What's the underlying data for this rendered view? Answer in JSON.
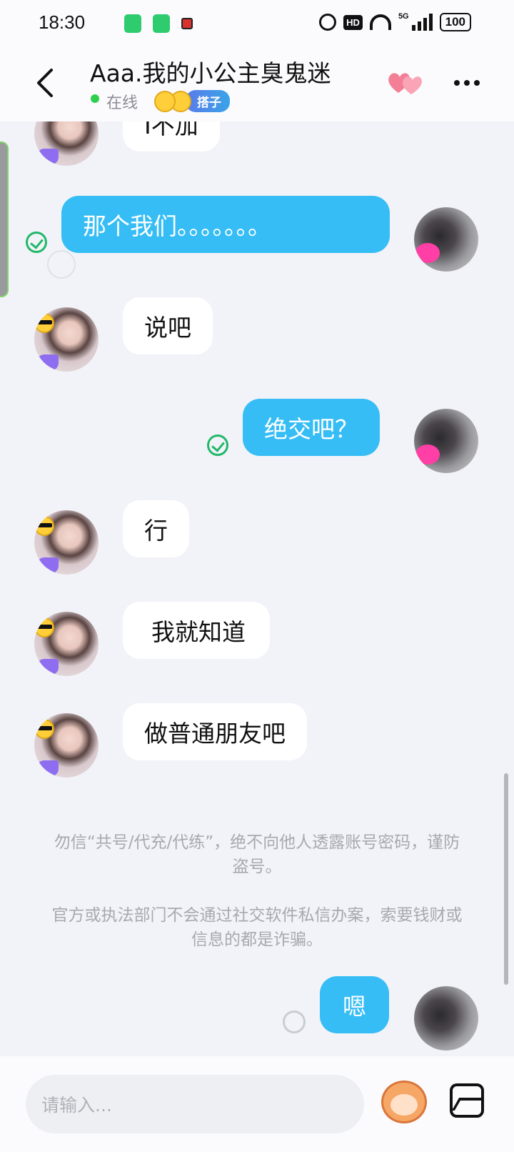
{
  "status_bar": {
    "time": "18:30",
    "network": "5G",
    "hd": "HD",
    "battery": "100"
  },
  "header": {
    "title": "Aaa.我的小公主臭鬼迷",
    "status": "在线",
    "tag": "搭子",
    "back_icon": "back-arrow-icon",
    "heart_icon": "hearts-icon",
    "more_icon": "more-dots-icon"
  },
  "messages": [
    {
      "side": "in",
      "text": "I不加"
    },
    {
      "side": "out",
      "text": "那个我们。。。。。。。"
    },
    {
      "side": "in",
      "text": "说吧"
    },
    {
      "side": "out",
      "text": "绝交吧？"
    },
    {
      "side": "in",
      "text": "行"
    },
    {
      "side": "in",
      "text": "我就知道"
    },
    {
      "side": "in",
      "text": "做普通朋友吧"
    }
  ],
  "notices": [
    "勿信“共号/代充/代练”，绝不向他人透露账号密码，谨防盗号。",
    "官方或执法部门不会通过社交软件私信办案，索要钱财或信息的都是诈骗。"
  ],
  "last_message": {
    "side": "out",
    "text": "嗯"
  },
  "input": {
    "placeholder": "请输入..."
  },
  "colors": {
    "accent": "#36bdf5",
    "online": "#2fd04f",
    "read": "#21b86a"
  }
}
